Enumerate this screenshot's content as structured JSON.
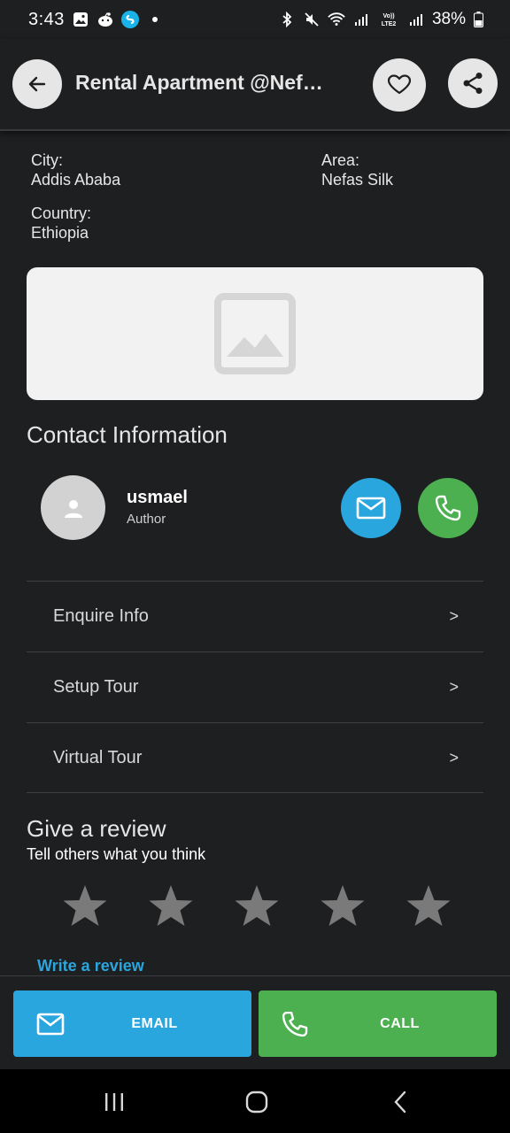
{
  "status_bar": {
    "time": "3:43",
    "battery": "38%",
    "left_icons": [
      "gallery-icon",
      "reddit-icon",
      "shazam-icon",
      "dot-icon"
    ],
    "right_icons": [
      "bluetooth-icon",
      "mute-icon",
      "wifi-icon",
      "signal-icon",
      "volte-icon",
      "signal-icon",
      "battery-icon"
    ],
    "volte_label": "Vo)) LTE2"
  },
  "header": {
    "title": "Rental Apartment @Nef…"
  },
  "location": {
    "city_label": "City:",
    "city_value": "Addis Ababa",
    "area_label": "Area:",
    "area_value": "Nefas Silk",
    "country_label": "Country:",
    "country_value": "Ethiopia"
  },
  "contact": {
    "section_title": "Contact Information",
    "author_name": "usmael",
    "author_role": "Author"
  },
  "menu": [
    {
      "label": "Enquire Info",
      "chevron": ">"
    },
    {
      "label": "Setup Tour",
      "chevron": ">"
    },
    {
      "label": "Virtual Tour",
      "chevron": ">"
    }
  ],
  "review": {
    "title": "Give a review",
    "subtitle": "Tell others what you think",
    "stars_total": 5,
    "stars_selected": 0,
    "write_link": "Write a review"
  },
  "actions": {
    "email_label": "EMAIL",
    "call_label": "CALL"
  },
  "colors": {
    "background": "#1e1f21",
    "email_blue": "#2aa6df",
    "call_green": "#4cb050",
    "star_gray": "#7a7a7a"
  }
}
